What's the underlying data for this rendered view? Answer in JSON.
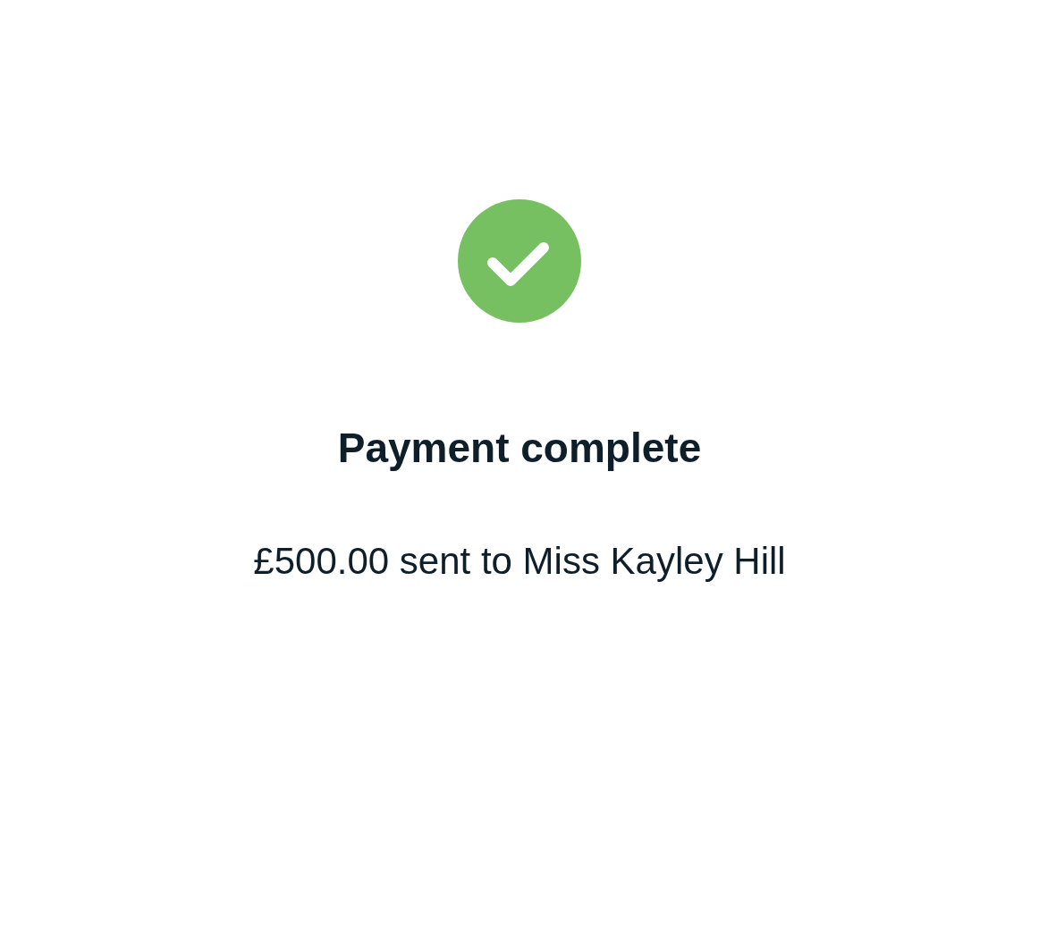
{
  "status": {
    "kind": "success"
  },
  "title": "Payment complete",
  "message": "£500.00 sent to Miss Kayley Hill"
}
